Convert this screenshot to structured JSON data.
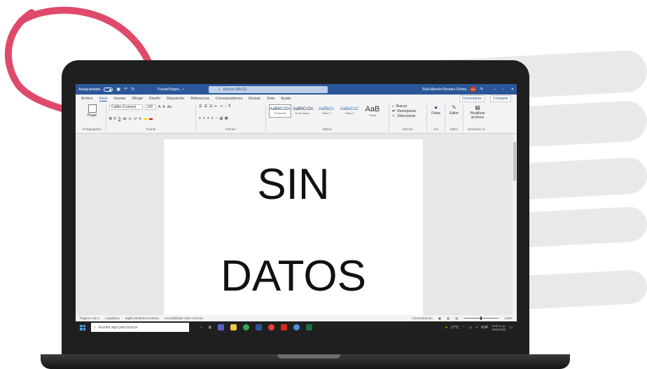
{
  "window": {
    "autosave_label": "Autoguardado",
    "doc_title": "FuenteOrigen... •",
    "search_placeholder": "Buscar (Alt+Q)",
    "user_name": "Raúl Alberto Rosales Ochoa",
    "user_initials": "RA"
  },
  "tabs": {
    "items": [
      "Archivo",
      "Inicio",
      "Insertar",
      "Dibujar",
      "Diseño",
      "Disposición",
      "Referencias",
      "Correspondencia",
      "Revisar",
      "Vista",
      "Ayuda"
    ],
    "comments_label": "Comentarios",
    "share_label": "Compartir"
  },
  "ribbon": {
    "paste_label": "Pegar",
    "clipboard_label": "Portapapeles",
    "font_name": "Calibri (Cuerpo)",
    "font_size": "100",
    "font_group_label": "Fuente",
    "paragraph_label": "Párrafo",
    "styles": [
      {
        "sample": "AaBbCcDc",
        "name": "¶ Normal"
      },
      {
        "sample": "AaBbCcDc",
        "name": "¶ Sin espa..."
      },
      {
        "sample": "AaBbCc",
        "name": "Título 1"
      },
      {
        "sample": "AaBbCcC",
        "name": "Título 2"
      },
      {
        "sample": "AaB",
        "name": "Título"
      }
    ],
    "styles_label": "Estilos",
    "find_label": "Buscar",
    "replace_label": "Reemplazar",
    "select_label": "Seleccionar",
    "edit_label": "Edición",
    "dictate_label": "Dictar",
    "voice_label": "Voz",
    "editor_label": "Editor",
    "editor_group_label": "Editor",
    "reuse_label": "Reutilizar archivos",
    "reuse_group_label": "Reutilizar ar..."
  },
  "document": {
    "line1": "SIN",
    "line2": "DATOS"
  },
  "statusbar": {
    "page": "Página 1 de 2",
    "words": "2 palabras",
    "language": "Inglés (Estados Unidos)",
    "accessibility": "Accesibilidad: todo correcto",
    "focus": "Concentración",
    "zoom": "100%"
  },
  "taskbar": {
    "search_placeholder": "Escribe aquí para buscar",
    "temperature": "17°C",
    "lang": "ESP",
    "time": "10:07 a. m.",
    "date": "22/07/2022"
  },
  "colors": {
    "word_blue": "#2b579a",
    "accent_pink": "#e04a6a"
  }
}
